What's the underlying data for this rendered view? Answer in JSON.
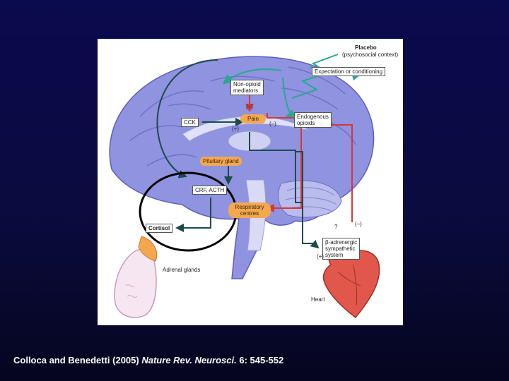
{
  "figure": {
    "labels": {
      "placebo": "Placebo",
      "psychosocial": "(psychosocial context)",
      "expectation": "Expectation or conditioning",
      "non_opioid_1": "Non-opioid",
      "non_opioid_2": "mediators",
      "cck": "CCK",
      "pain": "Pain",
      "endogenous_1": "Endogenous",
      "endogenous_2": "opioids",
      "pituitary": "Pituitary gland",
      "crf_acth": "CRF, ACTH",
      "respiratory_1": "Respiratory",
      "respiratory_2": "centres",
      "cortisol": "Cortisol",
      "beta_adrenergic_1": "β-adrenergic",
      "beta_adrenergic_2": "sympathetic",
      "beta_adrenergic_3": "system",
      "adrenal": "Adrenal glands",
      "heart": "Heart",
      "sign_minus": "(–)",
      "sign_plus": "(+)",
      "sign_question": "?"
    },
    "colors": {
      "brain": "#8f93e0",
      "pathway_dark": "#1d4a4a",
      "pathway_red": "#d23a3a",
      "expectation_arrow": "#27a98f",
      "pill": "#f3a850",
      "highlight_ellipse": "#000000"
    }
  },
  "caption": {
    "authors": "Colloca and Benedetti (2005)",
    "journal": "Nature Rev. Neurosci.",
    "citation": "6: 545-552"
  }
}
